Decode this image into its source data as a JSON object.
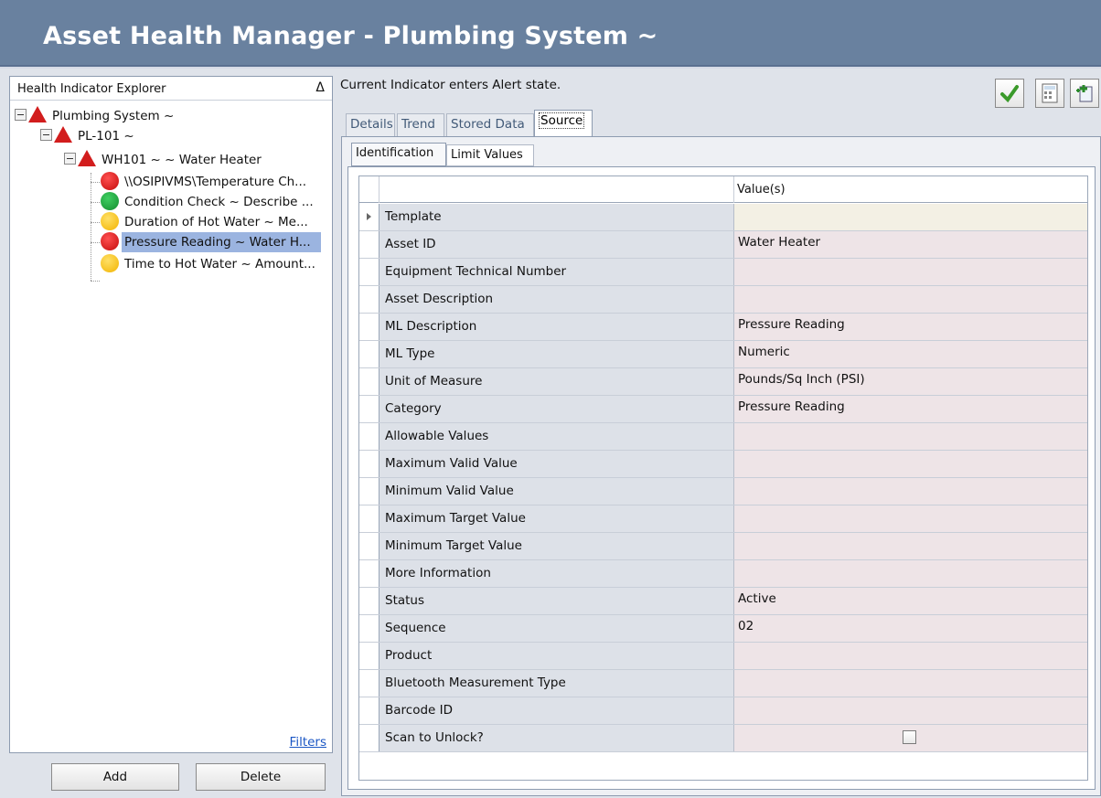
{
  "app": {
    "title": "Asset Health Manager - Plumbing System ~"
  },
  "explorer": {
    "header": "Health Indicator Explorer",
    "collapse_glyph": "Δ",
    "tree": {
      "root": "Plumbing System ~",
      "child": "PL-101 ~",
      "grandchild": "WH101 ~  ~ Water Heater",
      "indicators": [
        {
          "label": "\\\\OSIPIVMS\\Temperature Ch...",
          "status": "red"
        },
        {
          "label": "Condition Check ~ Describe ...",
          "status": "green"
        },
        {
          "label": "Duration of Hot Water ~ Me...",
          "status": "yellow"
        },
        {
          "label": "Pressure Reading ~ Water H...",
          "status": "red",
          "selected": true
        },
        {
          "label": "Time to Hot Water ~ Amount...",
          "status": "yellow"
        }
      ]
    },
    "filters_link": "Filters",
    "add_button": "Add",
    "delete_button": "Delete"
  },
  "main": {
    "message": "Current Indicator enters Alert state.",
    "toolbar_icons": [
      "checkmark-icon",
      "calculator-icon",
      "add-document-icon"
    ],
    "tabs": [
      "Details",
      "Trend",
      "Stored Data",
      "Source"
    ],
    "active_tab": "Source",
    "subtabs": [
      "Identification",
      "Limit Values"
    ],
    "grid": {
      "value_header": "Value(s)",
      "rows": [
        {
          "field": "Template",
          "value": ""
        },
        {
          "field": "Asset ID",
          "value": "Water Heater"
        },
        {
          "field": "Equipment Technical Number",
          "value": ""
        },
        {
          "field": "Asset Description",
          "value": ""
        },
        {
          "field": "ML Description",
          "value": "Pressure Reading"
        },
        {
          "field": "ML Type",
          "value": "Numeric"
        },
        {
          "field": "Unit of Measure",
          "value": "Pounds/Sq Inch (PSI)"
        },
        {
          "field": "Category",
          "value": "Pressure Reading"
        },
        {
          "field": "Allowable Values",
          "value": ""
        },
        {
          "field": "Maximum Valid Value",
          "value": ""
        },
        {
          "field": "Minimum Valid Value",
          "value": ""
        },
        {
          "field": "Maximum Target Value",
          "value": ""
        },
        {
          "field": "Minimum Target Value",
          "value": ""
        },
        {
          "field": "More Information",
          "value": ""
        },
        {
          "field": "Status",
          "value": "Active"
        },
        {
          "field": "Sequence",
          "value": "02"
        },
        {
          "field": "Product",
          "value": ""
        },
        {
          "field": "Bluetooth Measurement Type",
          "value": ""
        },
        {
          "field": "Barcode ID",
          "value": ""
        },
        {
          "field": "Scan to Unlock?",
          "value": ""
        }
      ]
    }
  },
  "colors": {
    "titlebar": "#69819f",
    "selected": "#9bb4e0",
    "alert_red": "#d21d1d",
    "ok_green": "#138c2e",
    "warn_yellow": "#f2b300"
  }
}
